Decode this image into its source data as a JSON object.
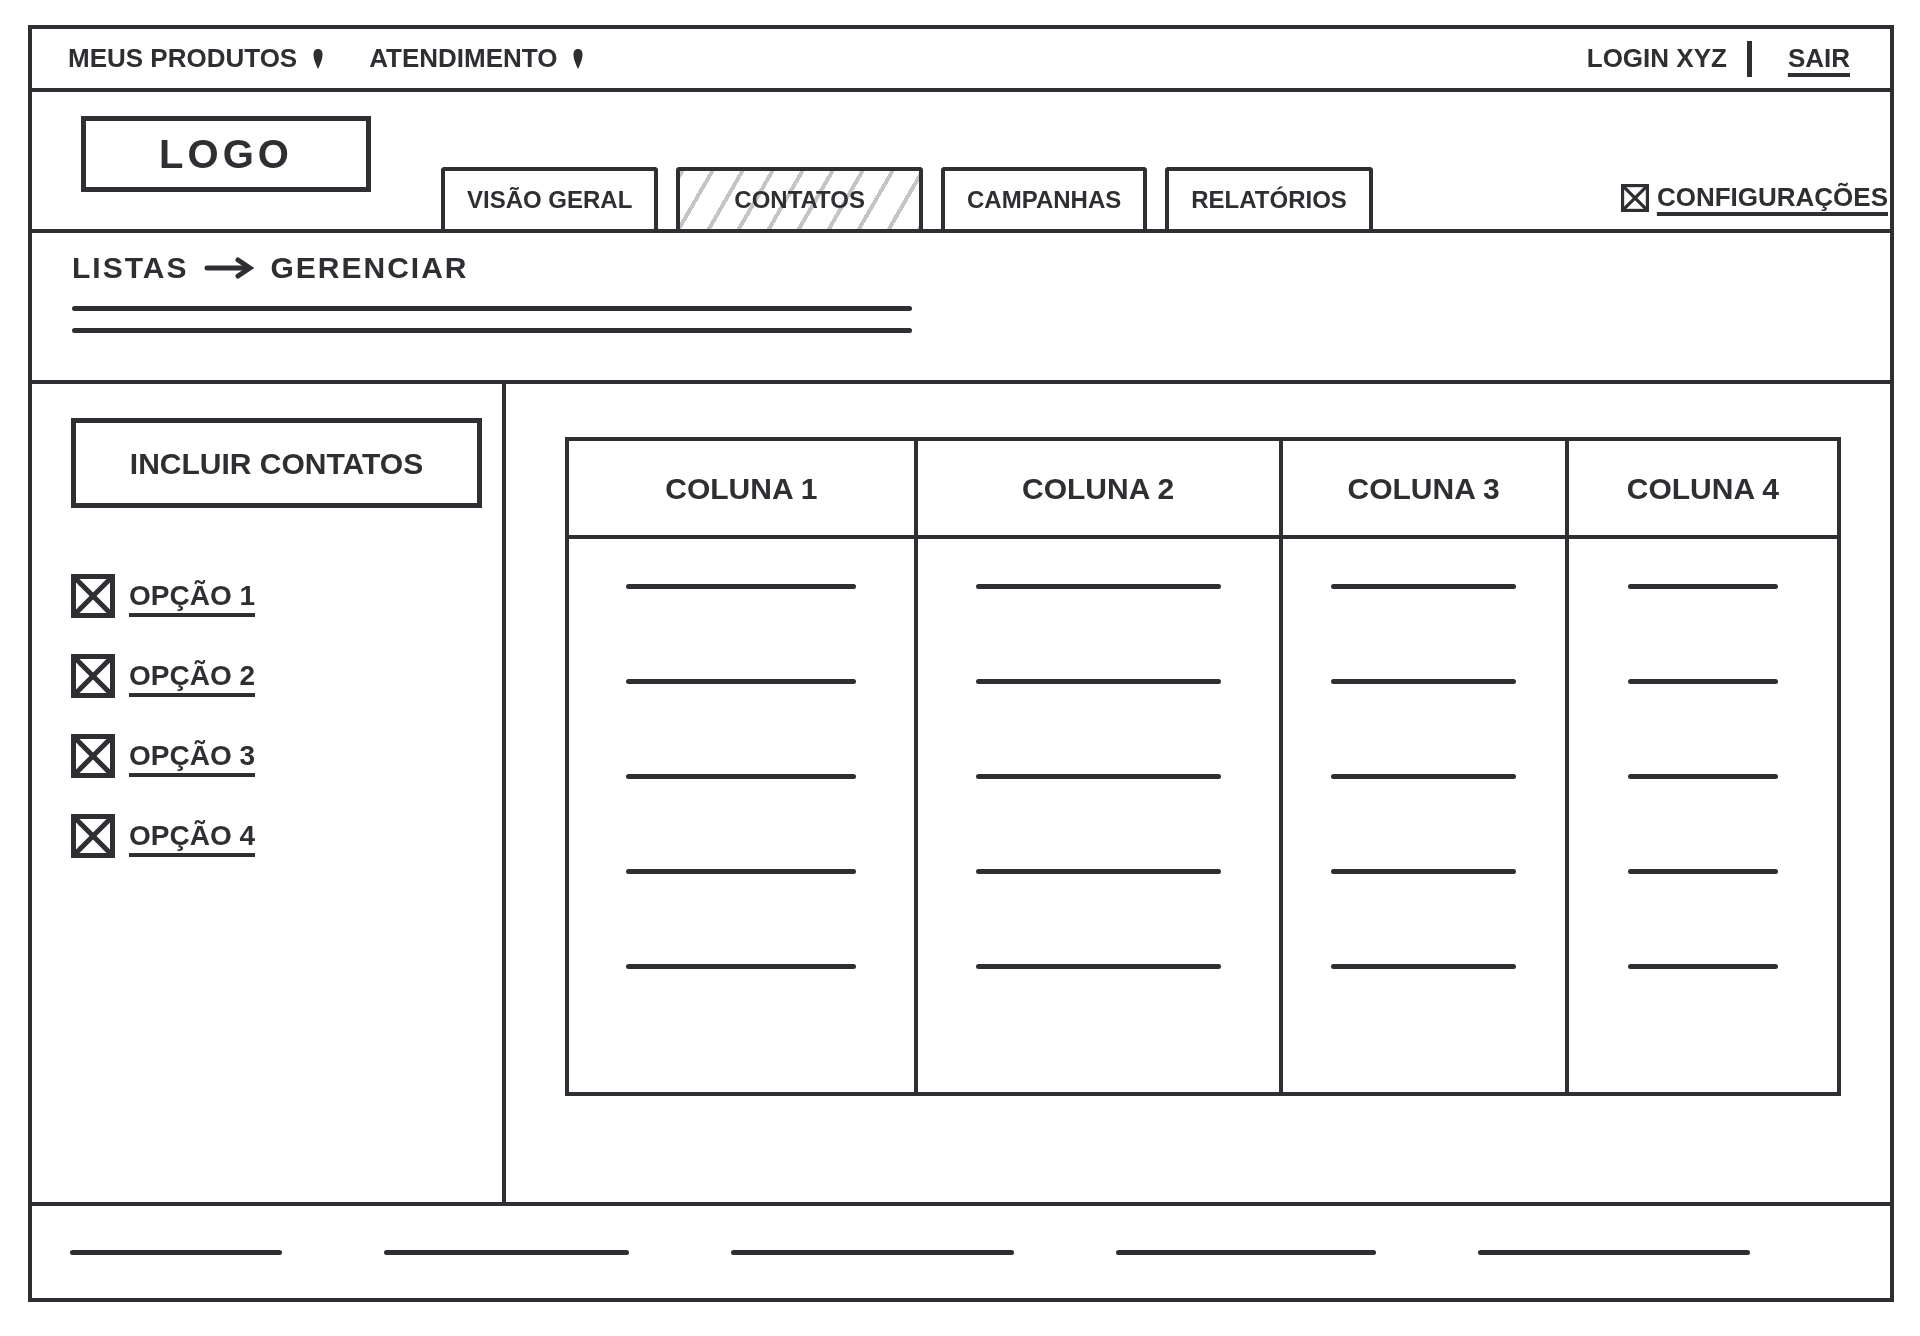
{
  "top_bar": {
    "menus": [
      {
        "label": "MEUS PRODUTOS",
        "has_dropdown": true
      },
      {
        "label": "ATENDIMENTO",
        "has_dropdown": true
      }
    ],
    "user": "LOGIN XYZ",
    "logout_link": "SAIR"
  },
  "header": {
    "logo": "LOGO",
    "tabs": [
      {
        "label": "VISÃO GERAL",
        "selected": false
      },
      {
        "label": "CONTATOS",
        "selected": true
      },
      {
        "label": "CAMPANHAS",
        "selected": false
      },
      {
        "label": "RELATÓRIOS",
        "selected": false
      }
    ],
    "settings_link": "CONFIGURAÇÕES"
  },
  "breadcrumb": {
    "items": [
      "LISTAS",
      "GERENCIAR"
    ],
    "description_lines": [
      {
        "kind": "placeholder"
      },
      {
        "kind": "placeholder"
      }
    ]
  },
  "sidebar": {
    "button": "INCLUIR CONTATOS",
    "options": [
      {
        "label": "OPÇÃO 1",
        "checked": true
      },
      {
        "label": "OPÇÃO 2",
        "checked": true
      },
      {
        "label": "OPÇÃO 3",
        "checked": true
      },
      {
        "label": "OPÇÃO 4",
        "checked": true
      }
    ]
  },
  "table": {
    "columns": [
      "COLUNA 1",
      "COLUNA 2",
      "COLUNA 3",
      "COLUNA 4"
    ],
    "rows": [
      {
        "kind": "placeholder"
      },
      {
        "kind": "placeholder"
      },
      {
        "kind": "placeholder"
      },
      {
        "kind": "placeholder"
      },
      {
        "kind": "placeholder"
      }
    ]
  },
  "footer": {
    "items": [
      {
        "kind": "placeholder"
      },
      {
        "kind": "placeholder"
      },
      {
        "kind": "placeholder"
      },
      {
        "kind": "placeholder"
      },
      {
        "kind": "placeholder"
      }
    ]
  }
}
